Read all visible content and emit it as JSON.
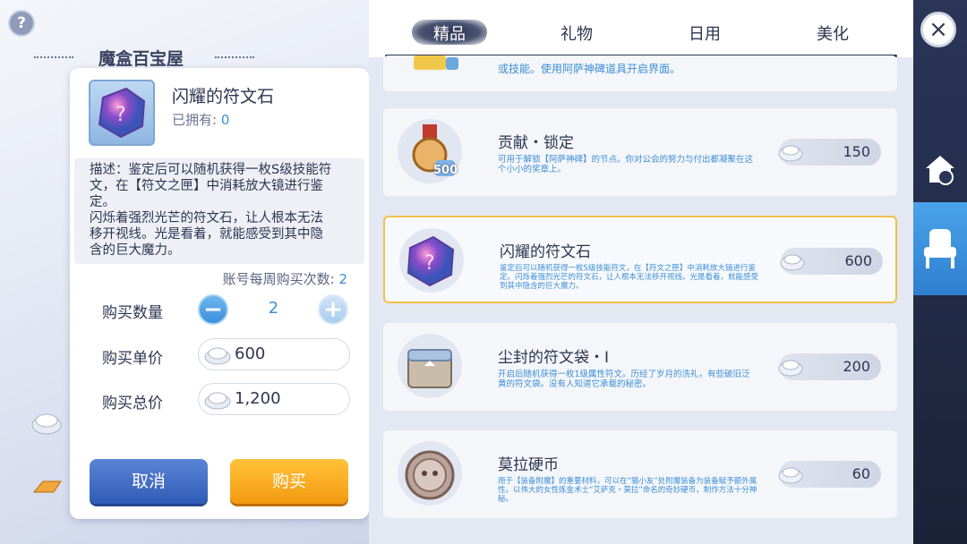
{
  "shop": {
    "title": "魔盒百宝屋",
    "help_label": "?"
  },
  "dialog": {
    "item_name": "闪耀的符文石",
    "owned_label": "已拥有:",
    "owned_value": "0",
    "description_lines": [
      "描述：鉴定后可以随机获得一枚S级技能符",
      "文，在【符文之匣】中消耗放大镜进行鉴",
      "定。",
      "闪烁着强烈光芒的符文石，让人根本无法",
      "移开视线。光是看着，就能感受到其中隐",
      "含的巨大魔力。"
    ],
    "weekly_label": "账号每周购买次数:",
    "weekly_value": "2",
    "qty_label": "购买数量",
    "qty_value": "2",
    "unit_price_label": "购买单价",
    "unit_price_value": "600",
    "total_label": "购买总价",
    "total_value": "1,200",
    "cancel_label": "取消",
    "buy_label": "购买"
  },
  "tabs": [
    {
      "label": "精品",
      "active": true
    },
    {
      "label": "礼物",
      "active": false
    },
    {
      "label": "日用",
      "active": false
    },
    {
      "label": "美化",
      "active": false
    }
  ],
  "items": [
    {
      "name": "",
      "desc": "或技能。使用阿萨神碑道具开启界面。",
      "price": ""
    },
    {
      "name": "贡献・锁定",
      "desc": "可用于解锁【阿萨神碑】的节点。你对公会的努力与付出都凝聚在这个小小的奖章上。",
      "price": "150",
      "badge": "500"
    },
    {
      "name": "闪耀的符文石",
      "desc": "鉴定后可以随机获得一枚S级技能符文，在【符文之匣】中消耗放大镜进行鉴定。闪烁着强烈光芒的符文石，让人根本无法移开视线。光是看着，就能感受到其中隐含的巨大魔力。",
      "price": "600"
    },
    {
      "name": "尘封的符文袋・Ⅰ",
      "desc": "开启后随机获得一枚1级属性符文。历经了岁月的洗礼，有些破旧泛黄的符文袋。没有人知道它承载的秘密。",
      "price": "200"
    },
    {
      "name": "莫拉硬币",
      "desc": "用于【装备附魔】的重要材料，可以在“猫小友”处附魔装备为装备赋予额外属性。以伟大的女性炼金术士“艾萨克・莫拉”命名的奇妙硬币，制作方法十分神秘。",
      "price": "60"
    }
  ],
  "colors": {
    "accent": "#3a8fd6",
    "buy": "#f49a10",
    "cancel": "#2f5cb6",
    "selected_border": "#f0c14a"
  },
  "icons": [
    "help-icon",
    "zeny-coin-icon",
    "close-icon",
    "home-icon",
    "chair-icon",
    "minus-icon",
    "plus-icon"
  ]
}
